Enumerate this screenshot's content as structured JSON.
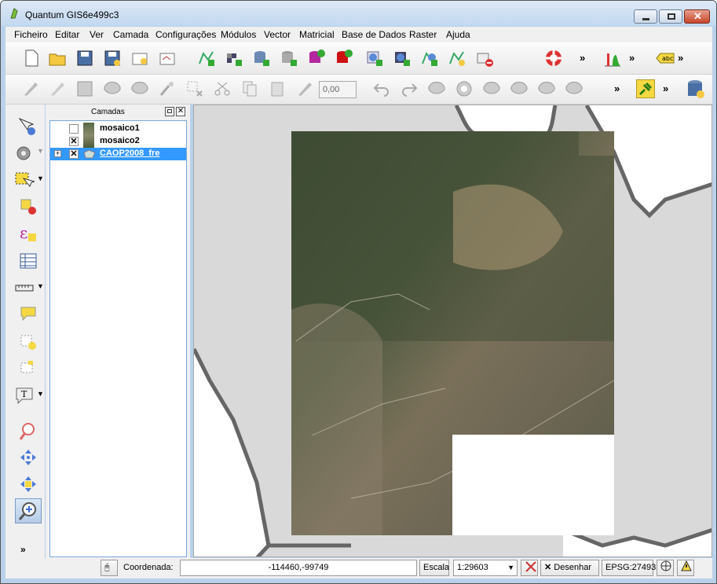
{
  "window": {
    "title": "Quantum GIS6e499c3"
  },
  "menu": [
    "Ficheiro",
    "Editar",
    "Ver",
    "Camada",
    "Configurações",
    "Módulos",
    "Vector",
    "Matricial",
    "Base de Dados",
    "Raster",
    "Ajuda"
  ],
  "toolbar": {
    "field_value": "0,00",
    "more": "»"
  },
  "layers_panel": {
    "title": "Camadas",
    "layers": [
      {
        "name": "mosaico1",
        "checked": false,
        "selected": false
      },
      {
        "name": "mosaico2",
        "checked": true,
        "selected": false
      },
      {
        "name": "CAOP2008_fre",
        "checked": true,
        "selected": true
      }
    ]
  },
  "statusbar": {
    "coord_label": "Coordenada:",
    "coord_value": "-114460,-99749",
    "scale_label": "Escala",
    "scale_value": "1:29603",
    "render_label": "Desenhar",
    "crs": "EPSG:27493"
  },
  "colors": {
    "selection": "#3399ff",
    "titlebar": "#c2d8ef",
    "canvas_bg": "#d9d9d9"
  }
}
